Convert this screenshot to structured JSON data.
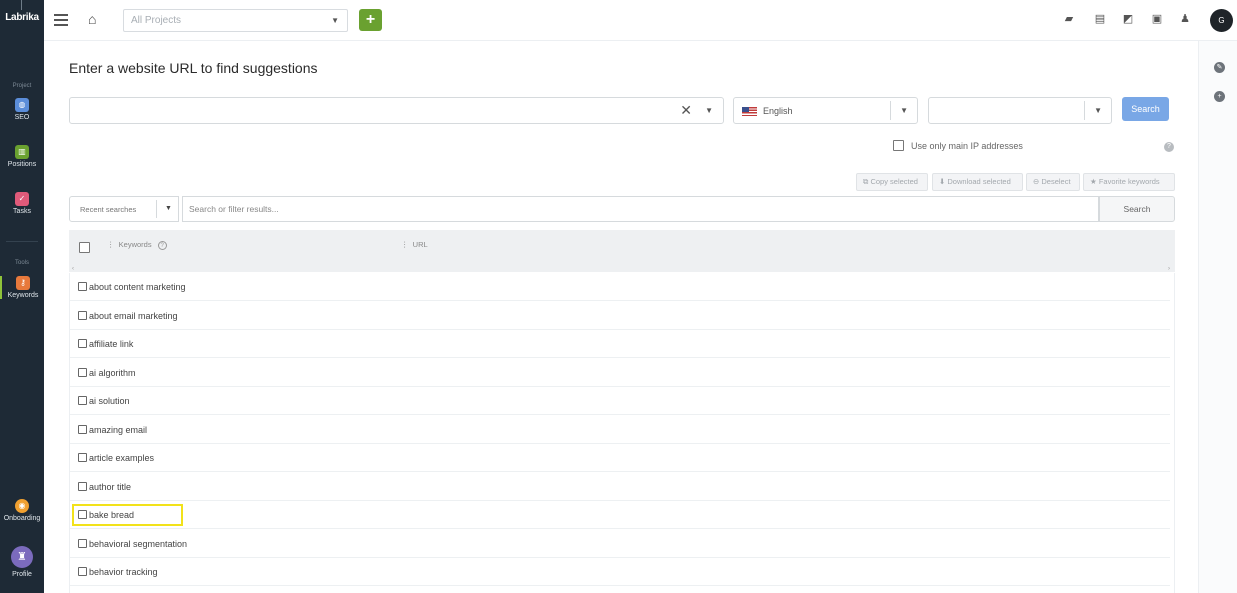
{
  "app": {
    "logo": "Labrika"
  },
  "sidebar": {
    "project_section": "Project",
    "tools_section": "Tools",
    "items": [
      {
        "label": "SEO",
        "icon": "seo-icon",
        "color": "#5b8dd9"
      },
      {
        "label": "Positions",
        "icon": "chart-icon",
        "color": "#6aa130"
      },
      {
        "label": "Tasks",
        "icon": "check-icon",
        "color": "#e05a7a"
      },
      {
        "label": "Keywords",
        "icon": "key-icon",
        "color": "#e7793c",
        "active": true
      },
      {
        "label": "Onboarding",
        "icon": "onboarding-icon",
        "color": "#f0a030"
      },
      {
        "label": "Profile",
        "icon": "profile-icon",
        "color": "#7b6bbd"
      }
    ]
  },
  "topbar": {
    "project_placeholder": "All Projects",
    "add_label": "+",
    "avatar_initial": "G"
  },
  "main": {
    "title": "Enter a website URL to find suggestions",
    "language": "English",
    "search_label": "Search",
    "ip_checkbox_label": "Use only main IP addresses",
    "actions": {
      "copy": "Copy selected",
      "download": "Download selected",
      "deselect": "Deselect",
      "favorite": "Favorite keywords"
    },
    "recent_searches": "Recent searches",
    "filter_placeholder": "Search or filter results...",
    "filter_button": "Search",
    "columns": {
      "keywords": "Keywords",
      "url": "URL"
    },
    "rows": [
      "about content marketing",
      "about email marketing",
      "affiliate link",
      "ai algorithm",
      "ai solution",
      "amazing email",
      "article examples",
      "author title",
      "bake bread",
      "behavioral segmentation",
      "behavior tracking"
    ],
    "highlighted_row": "bake bread"
  },
  "colors": {
    "sidebar_bg": "#1e2a36",
    "primary_green": "#6aa130",
    "search_blue": "#79a7e6",
    "highlight": "#f2e21a"
  }
}
